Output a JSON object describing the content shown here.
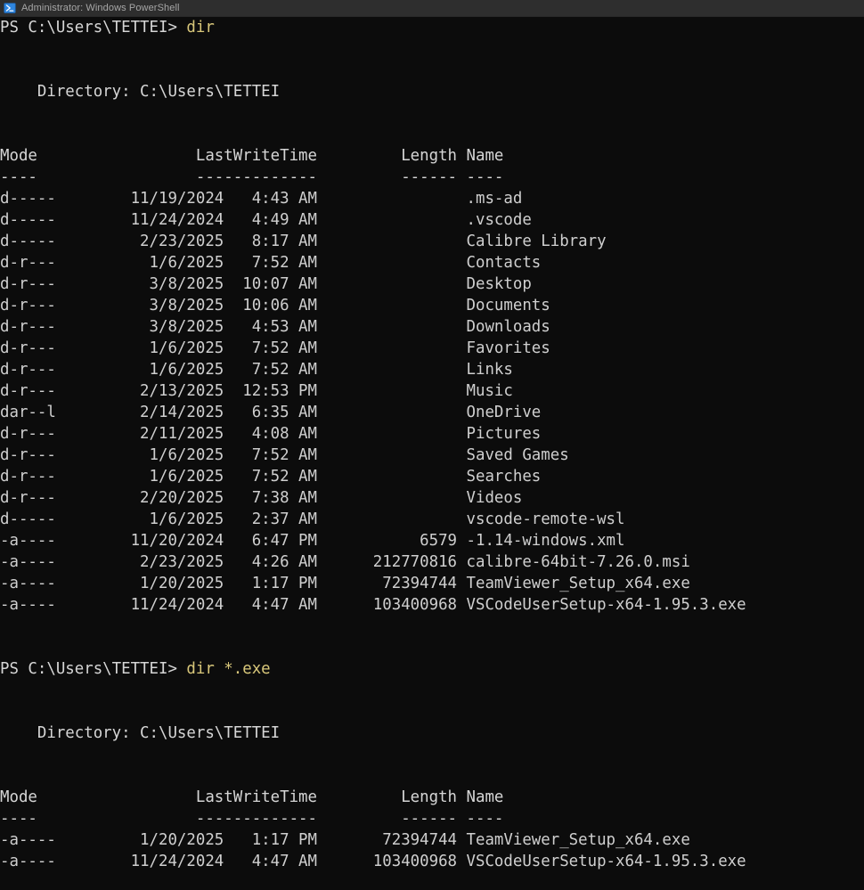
{
  "window": {
    "title": "Administrator: Windows PowerShell",
    "icon": "powershell-icon",
    "titlebar_bg": "#2e2e2e",
    "console_bg": "#0c0c0c",
    "text_color": "#cccccc",
    "command_color": "#d8c77a"
  },
  "session": {
    "prompt": "PS C:\\Users\\TETTEI>",
    "blocks": [
      {
        "command": "dir",
        "directory_label": "    Directory: C:\\Users\\TETTEI",
        "headers": {
          "mode": "Mode",
          "lastwritetime": "LastWriteTime",
          "length": "Length",
          "name": "Name"
        },
        "header_line": "Mode                 LastWriteTime         Length Name",
        "divider_line": "----                 -------------         ------ ----",
        "entries": [
          {
            "mode": "d-----",
            "date": "11/19/2024",
            "time": "4:43 AM",
            "length": "",
            "name": ".ms-ad",
            "line": "d-----        11/19/2024   4:43 AM                .ms-ad"
          },
          {
            "mode": "d-----",
            "date": "11/24/2024",
            "time": "4:49 AM",
            "length": "",
            "name": ".vscode",
            "line": "d-----        11/24/2024   4:49 AM                .vscode"
          },
          {
            "mode": "d-----",
            "date": "2/23/2025",
            "time": "8:17 AM",
            "length": "",
            "name": "Calibre Library",
            "line": "d-----         2/23/2025   8:17 AM                Calibre Library"
          },
          {
            "mode": "d-r---",
            "date": "1/6/2025",
            "time": "7:52 AM",
            "length": "",
            "name": "Contacts",
            "line": "d-r---          1/6/2025   7:52 AM                Contacts"
          },
          {
            "mode": "d-r---",
            "date": "3/8/2025",
            "time": "10:07 AM",
            "length": "",
            "name": "Desktop",
            "line": "d-r---          3/8/2025  10:07 AM                Desktop"
          },
          {
            "mode": "d-r---",
            "date": "3/8/2025",
            "time": "10:06 AM",
            "length": "",
            "name": "Documents",
            "line": "d-r---          3/8/2025  10:06 AM                Documents"
          },
          {
            "mode": "d-r---",
            "date": "3/8/2025",
            "time": "4:53 AM",
            "length": "",
            "name": "Downloads",
            "line": "d-r---          3/8/2025   4:53 AM                Downloads"
          },
          {
            "mode": "d-r---",
            "date": "1/6/2025",
            "time": "7:52 AM",
            "length": "",
            "name": "Favorites",
            "line": "d-r---          1/6/2025   7:52 AM                Favorites"
          },
          {
            "mode": "d-r---",
            "date": "1/6/2025",
            "time": "7:52 AM",
            "length": "",
            "name": "Links",
            "line": "d-r---          1/6/2025   7:52 AM                Links"
          },
          {
            "mode": "d-r---",
            "date": "2/13/2025",
            "time": "12:53 PM",
            "length": "",
            "name": "Music",
            "line": "d-r---         2/13/2025  12:53 PM                Music"
          },
          {
            "mode": "dar--l",
            "date": "2/14/2025",
            "time": "6:35 AM",
            "length": "",
            "name": "OneDrive",
            "line": "dar--l         2/14/2025   6:35 AM                OneDrive"
          },
          {
            "mode": "d-r---",
            "date": "2/11/2025",
            "time": "4:08 AM",
            "length": "",
            "name": "Pictures",
            "line": "d-r---         2/11/2025   4:08 AM                Pictures"
          },
          {
            "mode": "d-r---",
            "date": "1/6/2025",
            "time": "7:52 AM",
            "length": "",
            "name": "Saved Games",
            "line": "d-r---          1/6/2025   7:52 AM                Saved Games"
          },
          {
            "mode": "d-r---",
            "date": "1/6/2025",
            "time": "7:52 AM",
            "length": "",
            "name": "Searches",
            "line": "d-r---          1/6/2025   7:52 AM                Searches"
          },
          {
            "mode": "d-r---",
            "date": "2/20/2025",
            "time": "7:38 AM",
            "length": "",
            "name": "Videos",
            "line": "d-r---         2/20/2025   7:38 AM                Videos"
          },
          {
            "mode": "d-----",
            "date": "1/6/2025",
            "time": "2:37 AM",
            "length": "",
            "name": "vscode-remote-wsl",
            "line": "d-----          1/6/2025   2:37 AM                vscode-remote-wsl"
          },
          {
            "mode": "-a----",
            "date": "11/20/2024",
            "time": "6:47 PM",
            "length": "6579",
            "name": "-1.14-windows.xml",
            "line": "-a----        11/20/2024   6:47 PM           6579 -1.14-windows.xml"
          },
          {
            "mode": "-a----",
            "date": "2/23/2025",
            "time": "4:26 AM",
            "length": "212770816",
            "name": "calibre-64bit-7.26.0.msi",
            "line": "-a----         2/23/2025   4:26 AM      212770816 calibre-64bit-7.26.0.msi"
          },
          {
            "mode": "-a----",
            "date": "1/20/2025",
            "time": "1:17 PM",
            "length": "72394744",
            "name": "TeamViewer_Setup_x64.exe",
            "line": "-a----         1/20/2025   1:17 PM       72394744 TeamViewer_Setup_x64.exe"
          },
          {
            "mode": "-a----",
            "date": "11/24/2024",
            "time": "4:47 AM",
            "length": "103400968",
            "name": "VSCodeUserSetup-x64-1.95.3.exe",
            "line": "-a----        11/24/2024   4:47 AM      103400968 VSCodeUserSetup-x64-1.95.3.exe"
          }
        ]
      },
      {
        "command": "dir *.exe",
        "directory_label": "    Directory: C:\\Users\\TETTEI",
        "headers": {
          "mode": "Mode",
          "lastwritetime": "LastWriteTime",
          "length": "Length",
          "name": "Name"
        },
        "header_line": "Mode                 LastWriteTime         Length Name",
        "divider_line": "----                 -------------         ------ ----",
        "entries": [
          {
            "mode": "-a----",
            "date": "1/20/2025",
            "time": "1:17 PM",
            "length": "72394744",
            "name": "TeamViewer_Setup_x64.exe",
            "line": "-a----         1/20/2025   1:17 PM       72394744 TeamViewer_Setup_x64.exe"
          },
          {
            "mode": "-a----",
            "date": "11/24/2024",
            "time": "4:47 AM",
            "length": "103400968",
            "name": "VSCodeUserSetup-x64-1.95.3.exe",
            "line": "-a----        11/24/2024   4:47 AM      103400968 VSCodeUserSetup-x64-1.95.3.exe"
          }
        ]
      }
    ]
  }
}
